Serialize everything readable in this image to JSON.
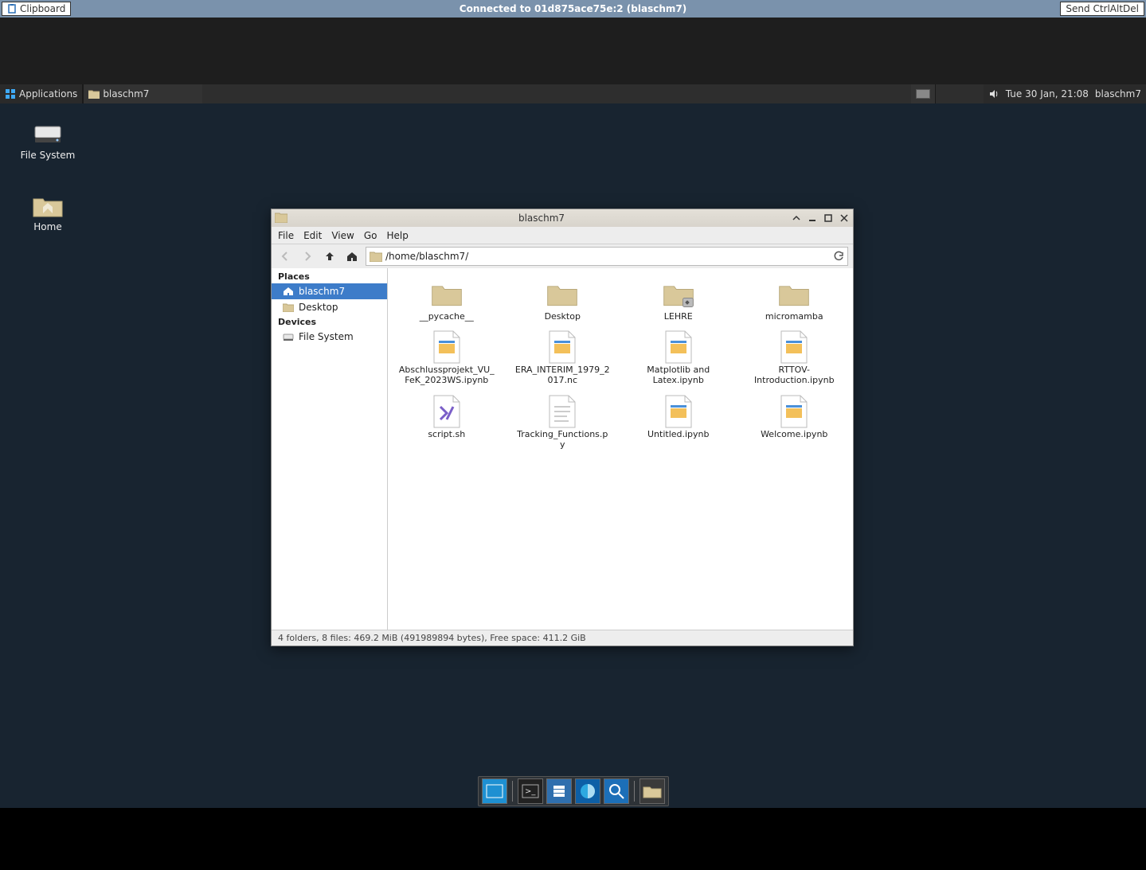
{
  "vnc": {
    "clipboard_label": "Clipboard",
    "connection_text": "Connected to 01d875ace75e:2 (blaschm7)",
    "cad_label": "Send CtrlAltDel"
  },
  "panel": {
    "applications_label": "Applications",
    "task_label": "blaschm7",
    "datetime": "Tue 30 Jan, 21:08",
    "user": "blaschm7"
  },
  "desktop_icons": {
    "filesystem": "File System",
    "home": "Home"
  },
  "fm": {
    "title": "blaschm7",
    "menu": {
      "file": "File",
      "edit": "Edit",
      "view": "View",
      "go": "Go",
      "help": "Help"
    },
    "path": "/home/blaschm7/",
    "sidebar": {
      "places_heading": "Places",
      "items": [
        {
          "label": "blaschm7"
        },
        {
          "label": "Desktop"
        }
      ],
      "devices_heading": "Devices",
      "devices": [
        {
          "label": "File System"
        }
      ]
    },
    "files": [
      {
        "label": "__pycache__",
        "type": "folder"
      },
      {
        "label": "Desktop",
        "type": "folder"
      },
      {
        "label": "LEHRE",
        "type": "folder-link"
      },
      {
        "label": "micromamba",
        "type": "folder"
      },
      {
        "label": "Abschlussprojekt_VU_FeK_2023WS.ipynb",
        "type": "ipynb"
      },
      {
        "label": "ERA_INTERIM_1979_2017.nc",
        "type": "ipynb"
      },
      {
        "label": "Matplotlib and Latex.ipynb",
        "type": "ipynb"
      },
      {
        "label": "RTTOV-Introduction.ipynb",
        "type": "ipynb"
      },
      {
        "label": "script.sh",
        "type": "script"
      },
      {
        "label": "Tracking_Functions.py",
        "type": "text"
      },
      {
        "label": "Untitled.ipynb",
        "type": "ipynb"
      },
      {
        "label": "Welcome.ipynb",
        "type": "ipynb"
      }
    ],
    "status": "4 folders, 8 files: 469.2 MiB (491989894 bytes), Free space: 411.2 GiB"
  }
}
